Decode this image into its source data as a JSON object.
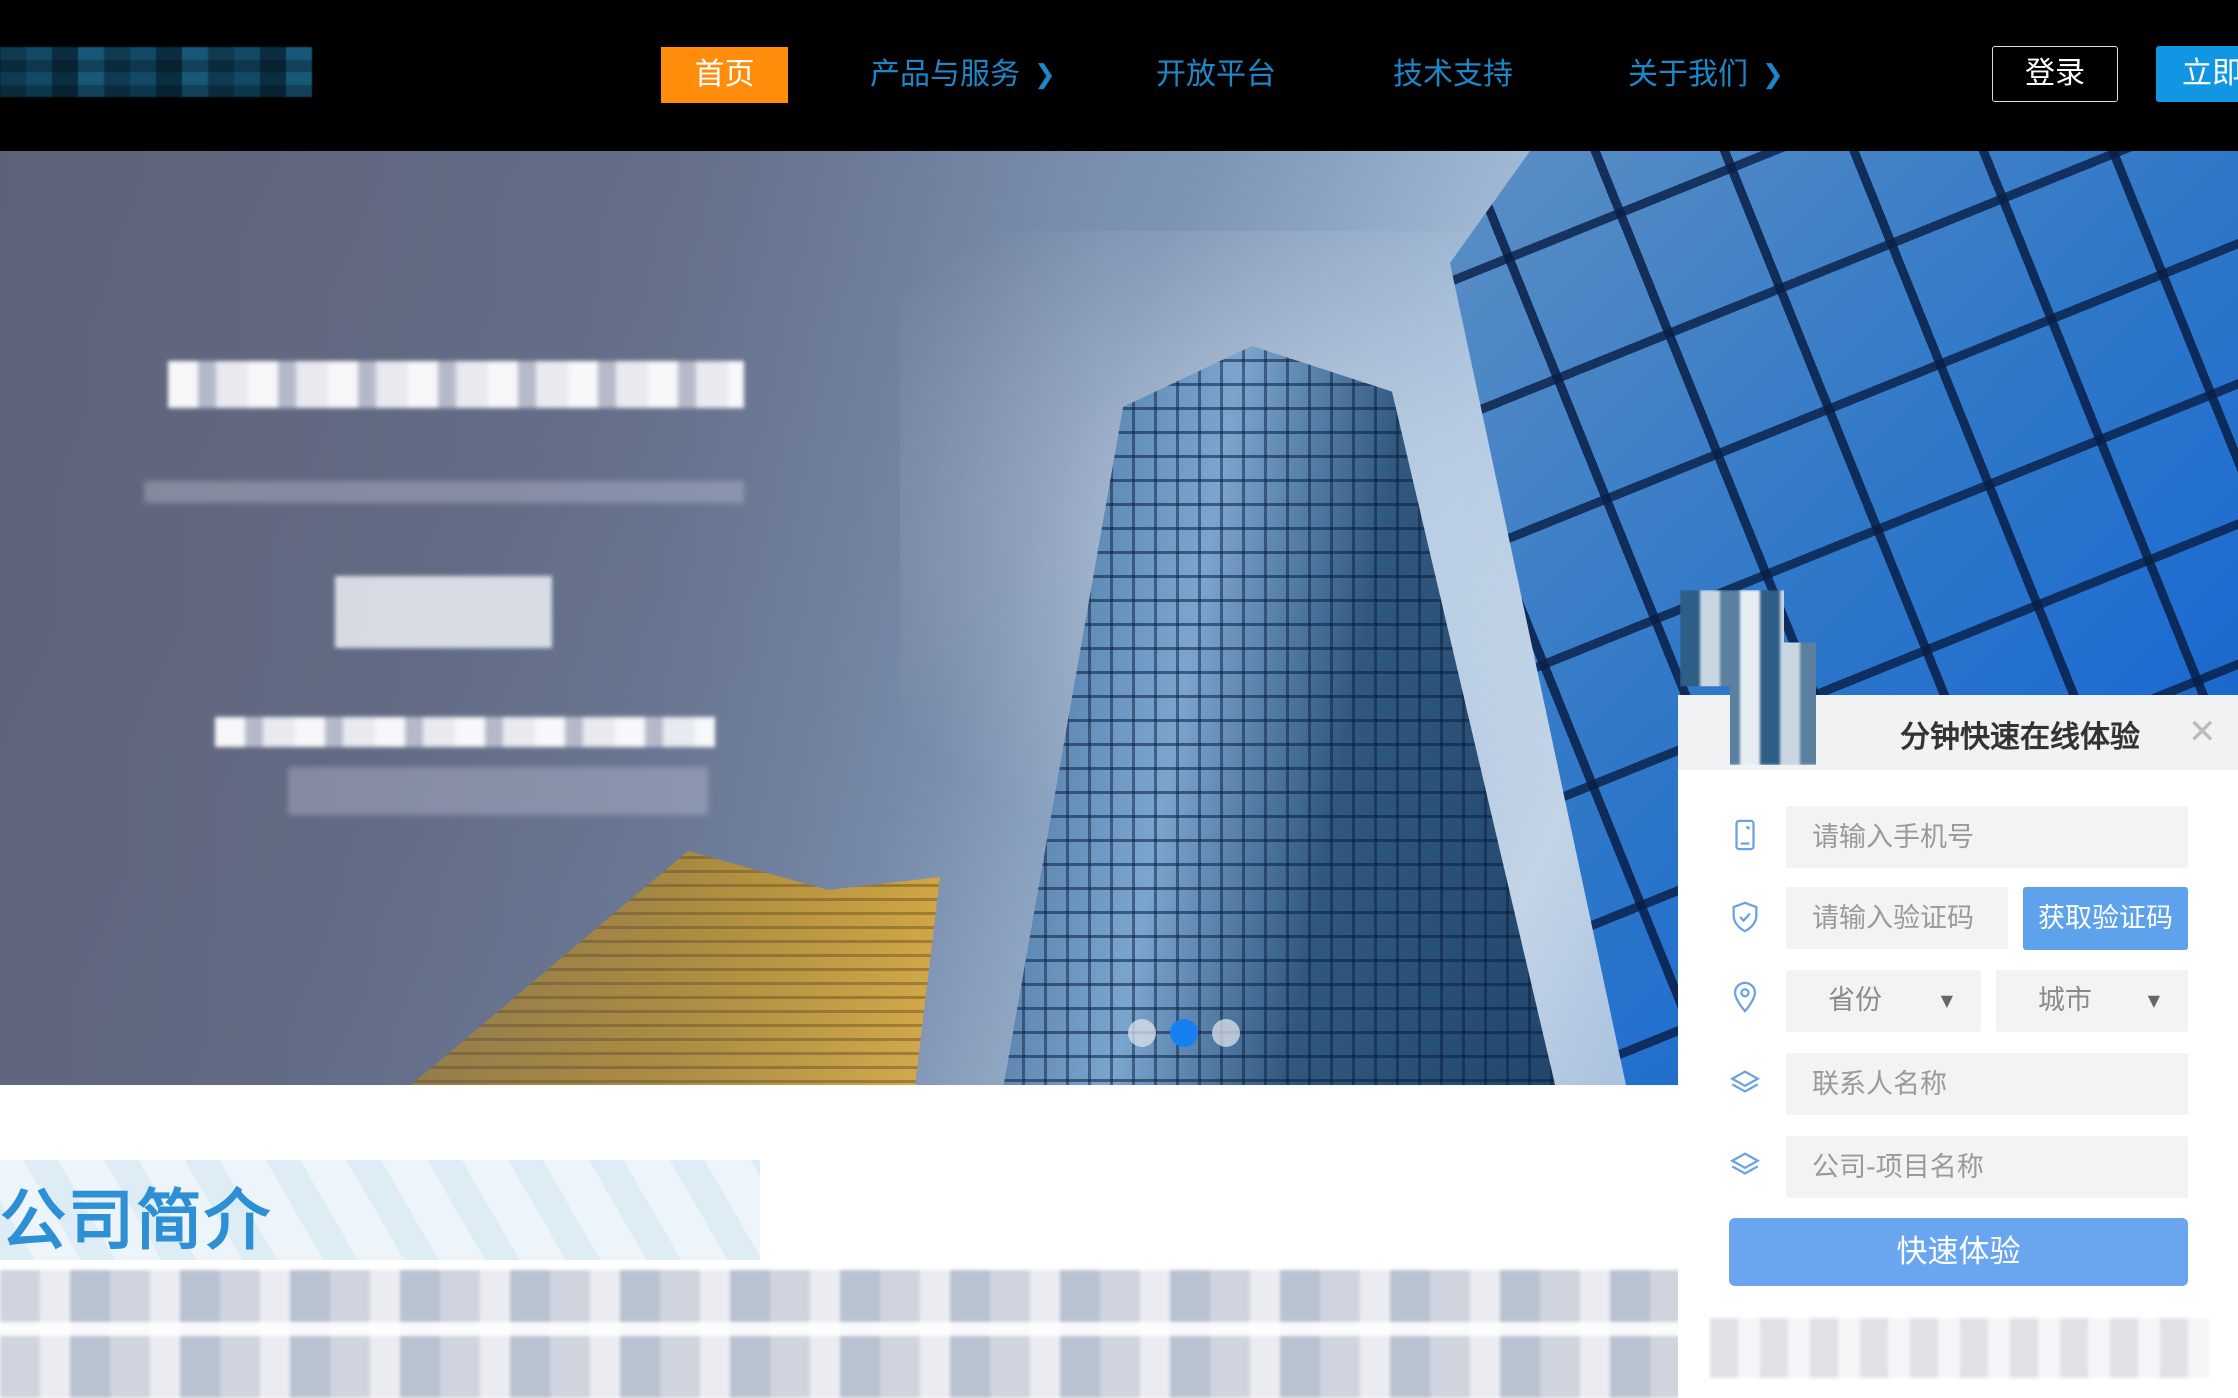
{
  "nav": {
    "home": "首页",
    "products": "产品与服务",
    "open_platform": "开放平台",
    "tech_support": "技术支持",
    "about": "关于我们",
    "login": "登录",
    "register": "立即"
  },
  "icons": {
    "chevron": "chevron-right-icon",
    "close": "close-icon",
    "phone": "phone-icon",
    "shield": "shield-check-icon",
    "location": "location-pin-icon",
    "layers": "layers-icon"
  },
  "carousel": {
    "slides": 3,
    "active_index": 1
  },
  "about": {
    "title": "公司简介"
  },
  "form": {
    "title": "分钟快速在线体验",
    "close": "✕",
    "phone_placeholder": "请输入手机号",
    "code_placeholder": "请输入验证码",
    "get_code": "获取验证码",
    "province": "省份",
    "city": "城市",
    "contact_placeholder": "联系人名称",
    "company_placeholder": "公司-项目名称",
    "submit": "快速体验"
  },
  "colors": {
    "accent_orange": "#ff8d0b",
    "nav_link": "#1c87c9",
    "register_bg": "#1196e4",
    "button_blue": "#6aa6ef",
    "icon_blue": "#6aa3e0",
    "carousel_active": "#1680f0"
  }
}
